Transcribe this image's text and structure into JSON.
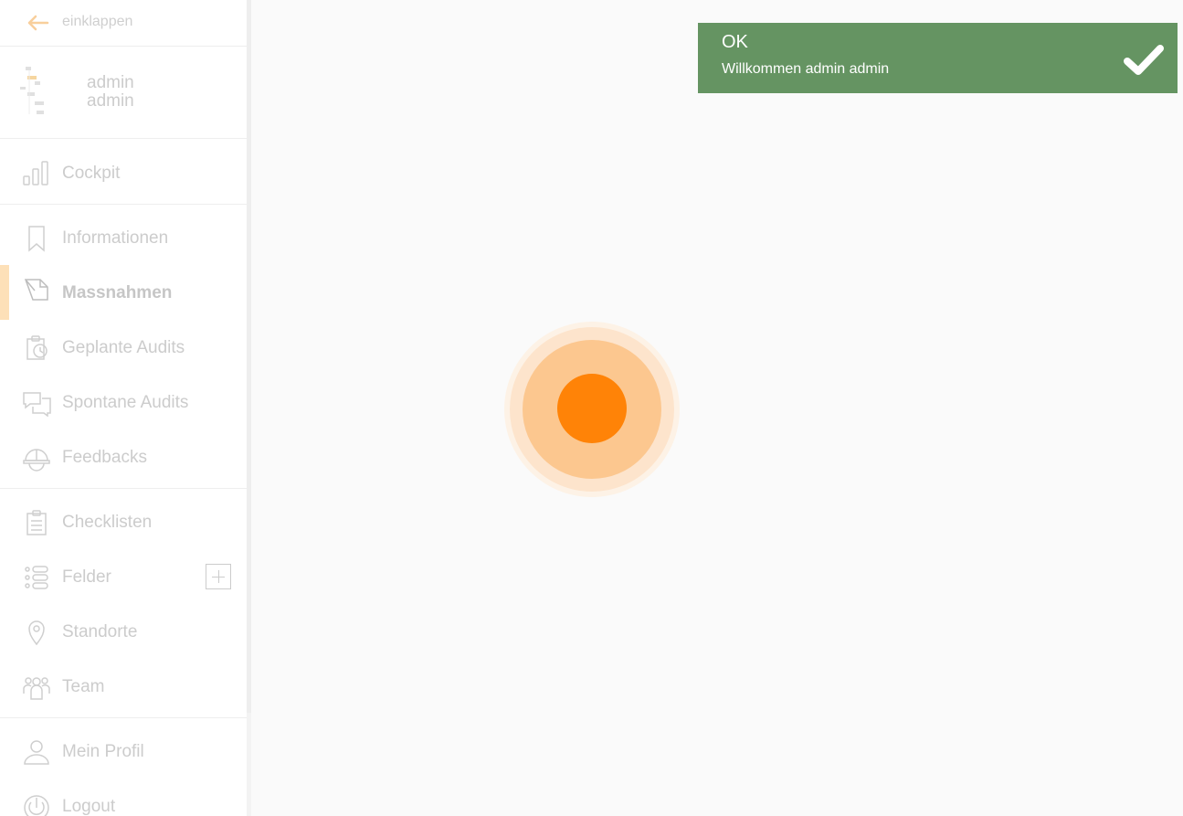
{
  "sidebar": {
    "collapse_label": "einklappen",
    "user": {
      "first_name": "admin",
      "last_name": "admin"
    },
    "groups": [
      [
        {
          "label": "Cockpit",
          "icon": "bar-chart-icon"
        }
      ],
      [
        {
          "label": "Informationen",
          "icon": "bookmark-icon"
        },
        {
          "label": "Massnahmen",
          "icon": "edit-document-icon",
          "active": true
        },
        {
          "label": "Geplante Audits",
          "icon": "clipboard-clock-icon"
        },
        {
          "label": "Spontane Audits",
          "icon": "chat-bubbles-icon"
        },
        {
          "label": "Feedbacks",
          "icon": "helmet-icon"
        }
      ],
      [
        {
          "label": "Checklisten",
          "icon": "checklist-icon"
        },
        {
          "label": "Felder",
          "icon": "list-icon",
          "has_add": true
        },
        {
          "label": "Standorte",
          "icon": "map-pin-icon"
        },
        {
          "label": "Team",
          "icon": "team-icon"
        }
      ],
      [
        {
          "label": "Mein Profil",
          "icon": "user-icon"
        },
        {
          "label": "Logout",
          "icon": "power-icon"
        }
      ]
    ]
  },
  "toast": {
    "title": "OK",
    "message": "Willkommen admin admin"
  },
  "colors": {
    "accent": "#ff8307",
    "toast_bg": "#659462",
    "active_bar": "#fde0b8"
  }
}
